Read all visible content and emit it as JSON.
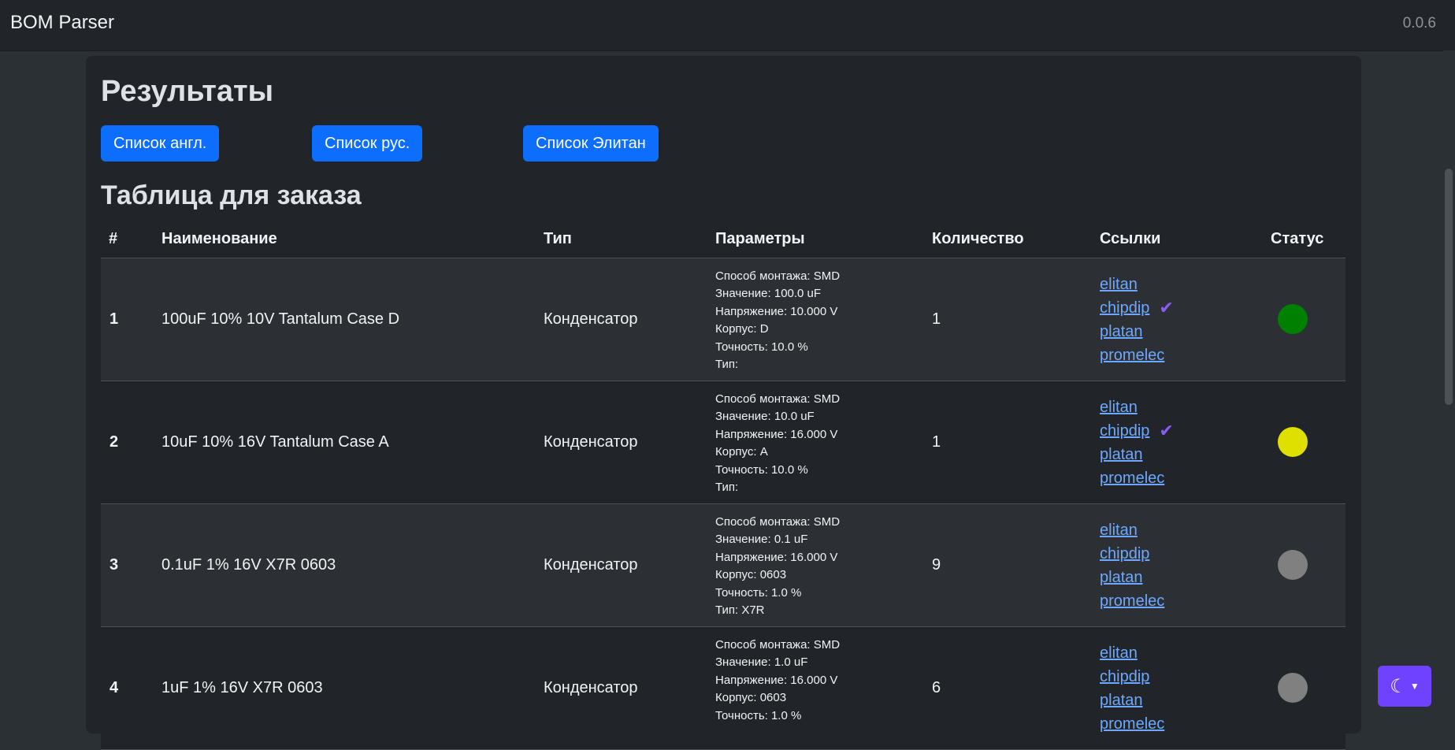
{
  "header": {
    "brand": "BOM Parser",
    "version": "0.0.6"
  },
  "results": {
    "title": "Результаты"
  },
  "buttons": {
    "list_en": "Список англ.",
    "list_ru": "Список рус.",
    "list_elitan": "Список Элитан"
  },
  "table": {
    "title": "Таблица для заказа",
    "headers": [
      "#",
      "Наименование",
      "Тип",
      "Параметры",
      "Количество",
      "Ссылки",
      "Статус"
    ],
    "rows": [
      {
        "num": "1",
        "name": "100uF 10% 10V Tantalum Case D",
        "type": "Конденсатор",
        "qty": "1",
        "params": [
          "Способ монтажа: SMD",
          "Значение: 100.0 uF",
          "Напряжение: 10.000 V",
          "Корпус: D",
          "Точность: 10.0 %",
          "Тип:"
        ],
        "links": [
          "elitan",
          "chipdip",
          "platan",
          "promelec"
        ],
        "status_color": "#008000"
      },
      {
        "num": "2",
        "name": "10uF 10% 16V Tantalum Case A",
        "type": "Конденсатор",
        "qty": "1",
        "params": [
          "Способ монтажа: SMD",
          "Значение: 10.0 uF",
          "Напряжение: 16.000 V",
          "Корпус: A",
          "Точность: 10.0 %",
          "Тип:"
        ],
        "links": [
          "elitan",
          "chipdip",
          "platan",
          "promelec"
        ],
        "status_color": "#e0e000"
      },
      {
        "num": "3",
        "name": "0.1uF 1% 16V X7R 0603",
        "type": "Конденсатор",
        "qty": "9",
        "params": [
          "Способ монтажа: SMD",
          "Значение: 0.1 uF",
          "Напряжение: 16.000 V",
          "Корпус: 0603",
          "Точность: 1.0 %",
          "Тип: X7R"
        ],
        "links": [
          "elitan",
          "chipdip",
          "platan",
          "promelec"
        ],
        "status_color": "#808080"
      },
      {
        "num": "4",
        "name": "1uF 1% 16V X7R 0603",
        "type": "Конденсатор",
        "qty": "6",
        "params": [
          "Способ монтажа: SMD",
          "Значение: 1.0 uF",
          "Напряжение: 16.000 V",
          "Корпус: 0603",
          "Точность: 1.0 %"
        ],
        "links": [
          "elitan",
          "chipdip",
          "platan",
          "promelec"
        ],
        "status_color": "#808080"
      }
    ]
  },
  "icons": {
    "theme_toggle": "moon-icon",
    "verified": "check-icon"
  }
}
